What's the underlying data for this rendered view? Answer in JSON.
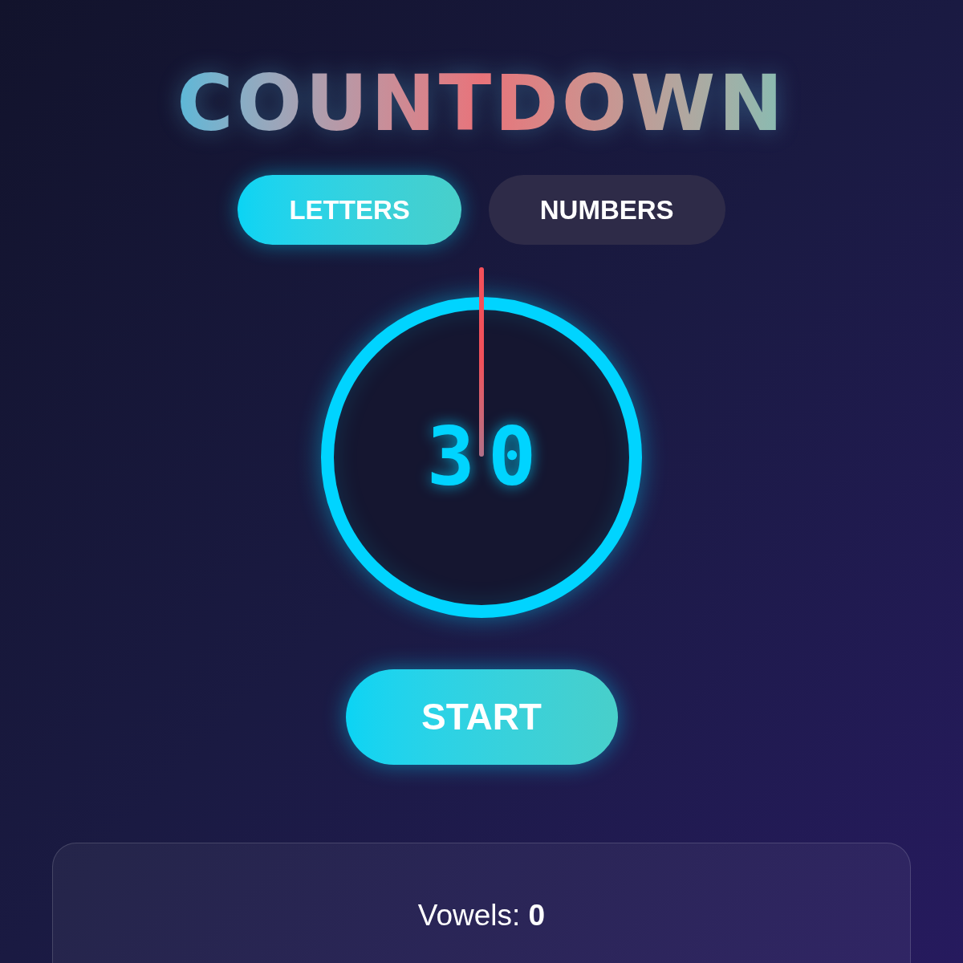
{
  "title": "COUNTDOWN",
  "tabs": [
    {
      "label": "LETTERS",
      "selected": true
    },
    {
      "label": "NUMBERS",
      "selected": false
    }
  ],
  "timer": {
    "value": "30"
  },
  "start_button": {
    "label": "START"
  },
  "stats": {
    "text": "Vowels: **0**"
  }
}
